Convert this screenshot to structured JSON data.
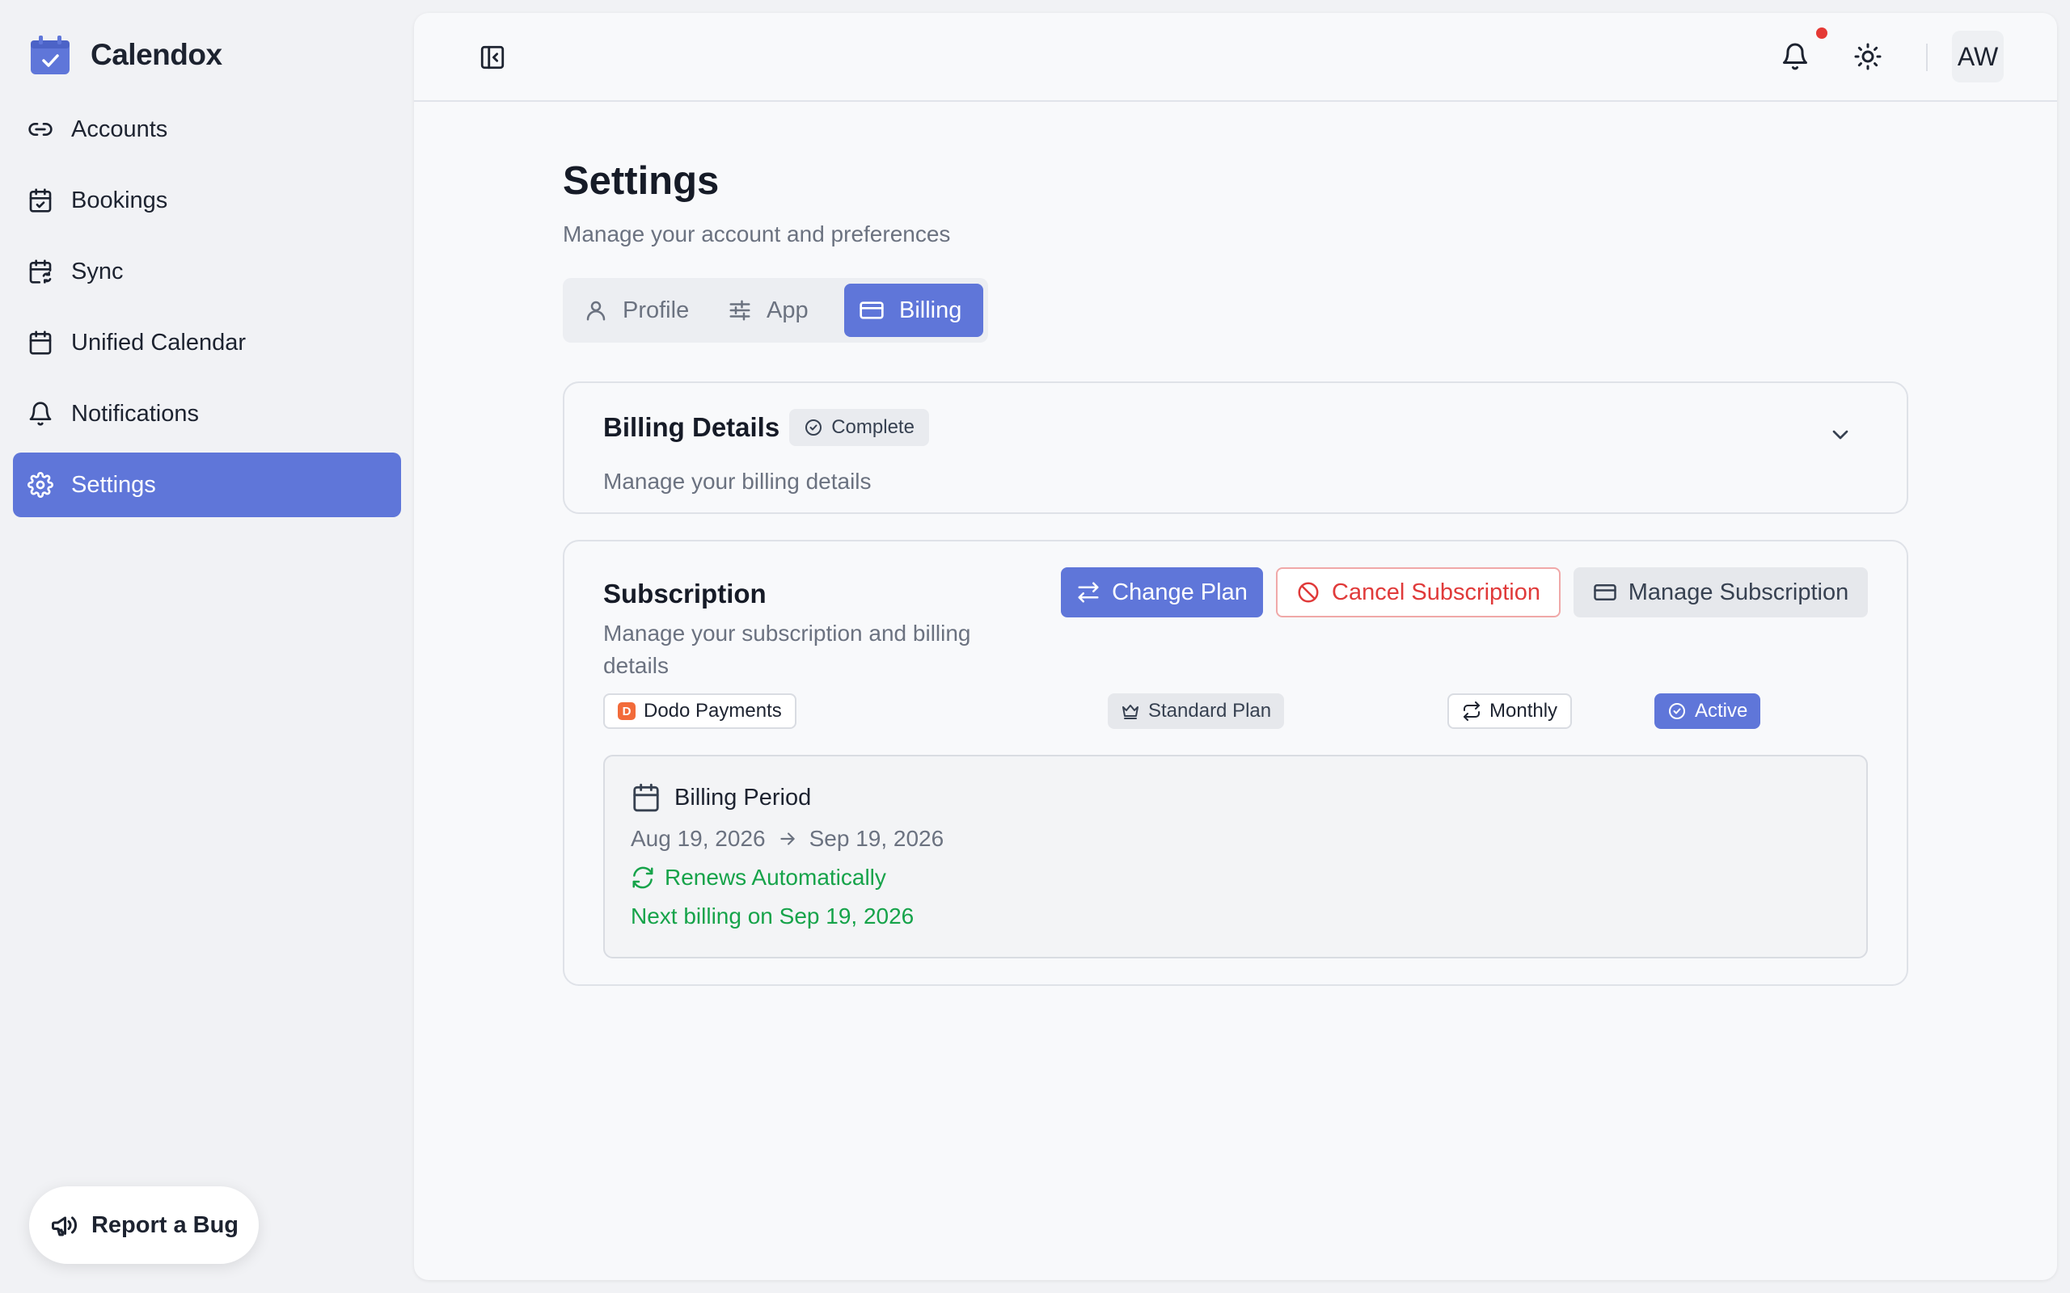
{
  "app": {
    "title": "Calendox"
  },
  "sidebar": {
    "items": [
      {
        "label": "Accounts",
        "icon": "link-icon"
      },
      {
        "label": "Bookings",
        "icon": "calendar-check-icon"
      },
      {
        "label": "Sync",
        "icon": "calendar-sync-icon"
      },
      {
        "label": "Unified Calendar",
        "icon": "calendar-icon"
      },
      {
        "label": "Notifications",
        "icon": "bell-icon"
      },
      {
        "label": "Settings",
        "icon": "gear-icon",
        "active": true
      }
    ],
    "report_bug": "Report a Bug"
  },
  "header": {
    "avatar": "AW"
  },
  "page": {
    "title": "Settings",
    "subtitle": "Manage your account and preferences"
  },
  "tabs": [
    {
      "label": "Profile"
    },
    {
      "label": "App"
    },
    {
      "label": "Billing",
      "active": true
    }
  ],
  "billing_details": {
    "title": "Billing Details",
    "badge": "Complete",
    "description": "Manage your billing details"
  },
  "subscription": {
    "title": "Subscription",
    "description": "Manage your subscription and billing details",
    "buttons": {
      "change_plan": "Change Plan",
      "cancel": "Cancel Subscription",
      "manage": "Manage Subscription"
    },
    "chips": {
      "provider": "Dodo Payments",
      "plan": "Standard Plan",
      "interval": "Monthly",
      "status": "Active"
    },
    "period": {
      "title": "Billing Period",
      "start": "Aug 19, 2026",
      "end": "Sep 19, 2026",
      "renew": "Renews Automatically",
      "next": "Next billing on Sep 19, 2026"
    }
  },
  "colors": {
    "accent": "#5f76d9",
    "danger": "#e03a3a",
    "success": "#16a34a",
    "provider_logo": "#f26b3a"
  }
}
